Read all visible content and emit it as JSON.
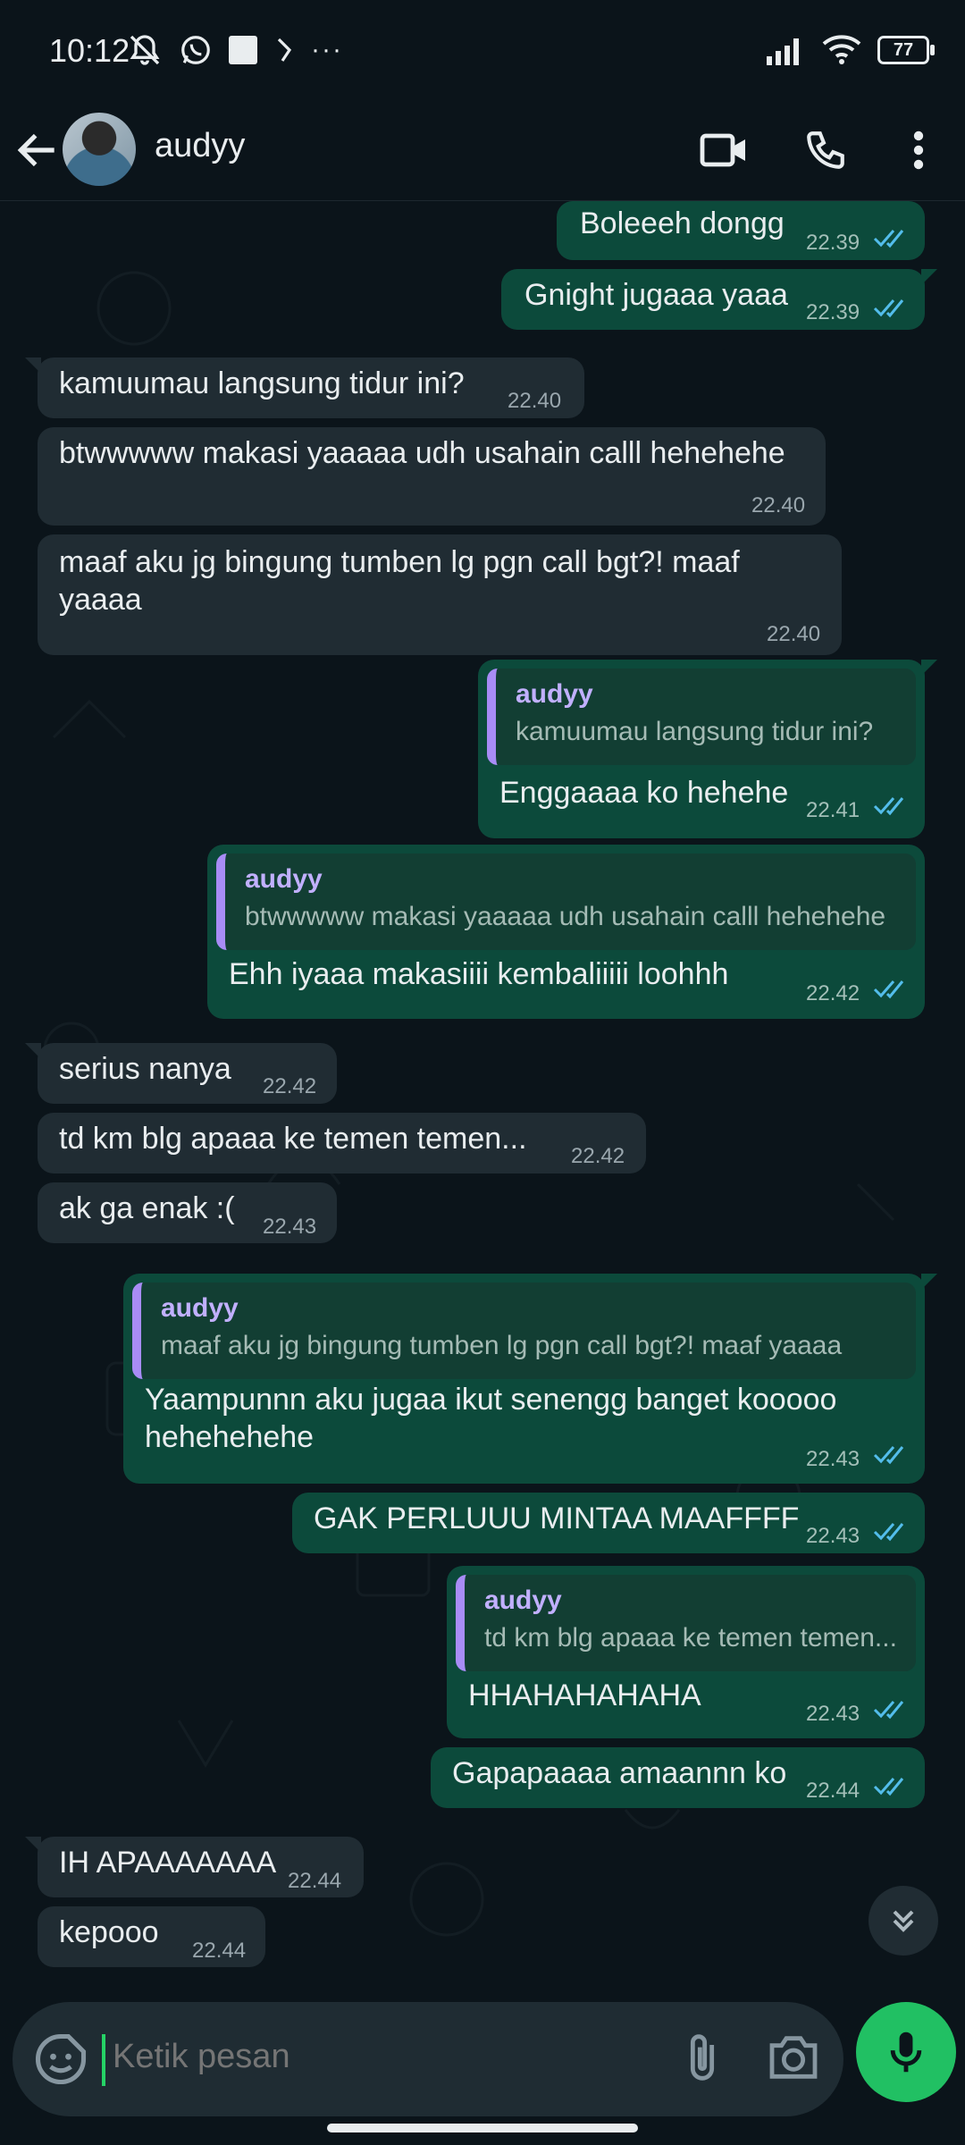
{
  "status_bar": {
    "time": "10:12",
    "battery": "77"
  },
  "header": {
    "contact_name": "audyy"
  },
  "messages": [
    {
      "text": "Boleeeh dongg",
      "time": "22.39"
    },
    {
      "text": "Gnight jugaaa yaaa",
      "time": "22.39"
    },
    {
      "text": "kamuumau langsung tidur ini?",
      "time": "22.40"
    },
    {
      "text": "btwwwww makasi yaaaaa udh usahain calll hehehehe",
      "time": "22.40"
    },
    {
      "text": "maaf aku jg bingung tumben lg pgn call bgt?! maaf\nyaaaa",
      "time": "22.40"
    },
    {
      "quote_name": "audyy",
      "quote_text": "kamuumau langsung tidur ini?",
      "text": "Enggaaaa ko hehehe",
      "time": "22.41"
    },
    {
      "quote_name": "audyy",
      "quote_text": "btwwwww makasi yaaaaa udh usahain calll hehehehe",
      "text": "Ehh iyaaa makasiiii kembaliiiii loohhh",
      "time": "22.42"
    },
    {
      "text": "serius nanya",
      "time": "22.42"
    },
    {
      "text": "td km blg apaaa ke temen temen...",
      "time": "22.42"
    },
    {
      "text": "ak ga enak :(",
      "time": "22.43"
    },
    {
      "quote_name": "audyy",
      "quote_text": "maaf aku jg bingung tumben lg pgn call bgt?! maaf yaaaa",
      "text": "Yaampunnn aku jugaa ikut senengg banget kooooo\nhehehehehe",
      "time": "22.43"
    },
    {
      "text": "GAK PERLUUU MINTAA MAAFFFF",
      "time": "22.43"
    },
    {
      "quote_name": "audyy",
      "quote_text": "td km blg apaaa ke temen temen...",
      "text": "HHAHAHAHAHA",
      "time": "22.43"
    },
    {
      "text": "Gapapaaaa amaannn ko",
      "time": "22.44"
    },
    {
      "text": "IH APAAAAAAA",
      "time": "22.44"
    },
    {
      "text": "kepooo",
      "time": "22.44"
    }
  ],
  "input": {
    "placeholder": "Ketik pesan"
  },
  "colors": {
    "incoming": "#202c33",
    "outgoing": "#0c4a3b",
    "accent": "#21c063",
    "read_ticks": "#53bdeb",
    "quote_bar": "#a88cf6"
  }
}
